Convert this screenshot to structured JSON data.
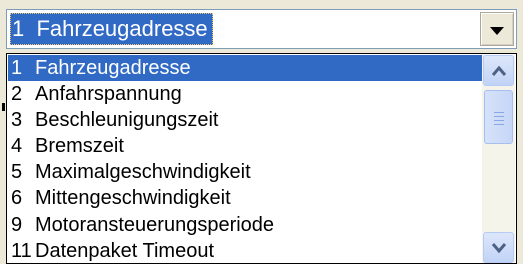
{
  "combo": {
    "selected_text": "1  Fahrzeugadresse"
  },
  "options": [
    {
      "num": "1",
      "label": "Fahrzeugadresse",
      "selected": true
    },
    {
      "num": "2",
      "label": "Anfahrspannung"
    },
    {
      "num": "3",
      "label": "Beschleunigungszeit"
    },
    {
      "num": "4",
      "label": "Bremszeit"
    },
    {
      "num": "5",
      "label": "Maximalgeschwindigkeit"
    },
    {
      "num": "6",
      "label": "Mittengeschwindigkeit"
    },
    {
      "num": "9",
      "label": "Motoransteuerungsperiode"
    },
    {
      "num": "11",
      "label": "Datenpaket Timeout"
    }
  ],
  "icons": {
    "dropdown": "chevron-down-icon",
    "scroll_up": "chevron-up-icon",
    "scroll_down": "chevron-down-icon"
  },
  "colors": {
    "selection": "#316ac5",
    "selection_text": "#ffffff",
    "scroll_arrow": "#4d6185"
  }
}
